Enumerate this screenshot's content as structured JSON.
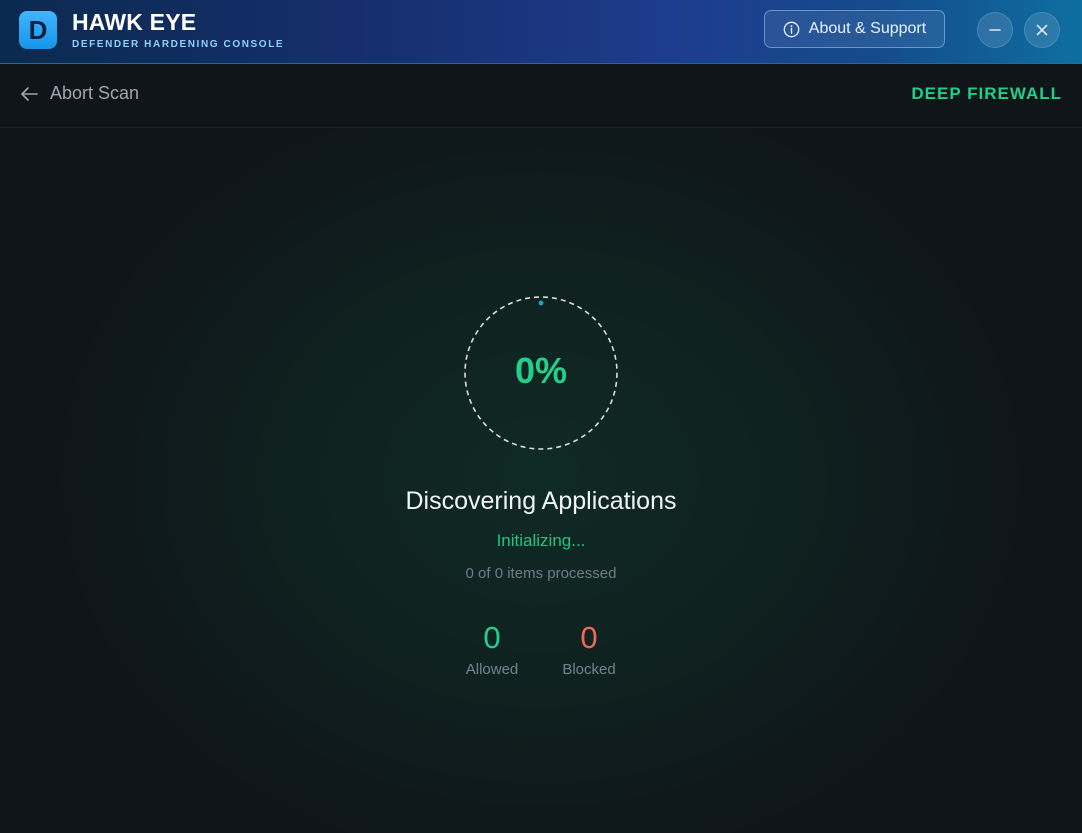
{
  "app": {
    "logo_letter": "D",
    "title": "HAWK EYE",
    "subtitle": "DEFENDER HARDENING CONSOLE"
  },
  "titlebar": {
    "about_label": "About & Support",
    "about_icon": "info-icon",
    "minimize_icon": "minimize-icon",
    "close_icon": "close-icon"
  },
  "subheader": {
    "abort_label": "Abort Scan",
    "abort_icon": "arrow-left-icon",
    "mode_label": "DEEP FIREWALL"
  },
  "scan": {
    "progress_percent": 0,
    "progress_text": "0%",
    "title": "Discovering Applications",
    "status": "Initializing...",
    "items_processed": "0 of 0 items processed"
  },
  "stats": {
    "allowed_value": "0",
    "allowed_label": "Allowed",
    "blocked_value": "0",
    "blocked_label": "Blocked"
  },
  "colors": {
    "accent_green": "#22cf8b",
    "blocked_red": "#f0675a",
    "logo_blue": "#2aa6f5",
    "ring_dot": "#1aa7c7"
  }
}
